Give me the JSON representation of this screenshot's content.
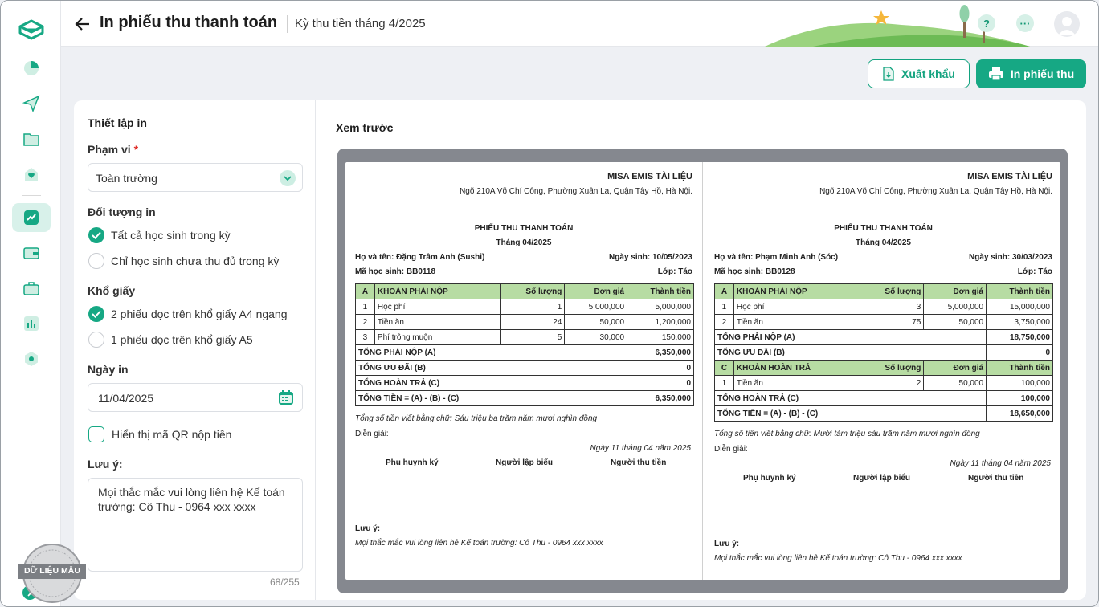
{
  "header": {
    "title": "In phiếu thu thanh toán",
    "period": "Kỳ thu tiền tháng 4/2025",
    "help_label": "?",
    "more_label": "···"
  },
  "actions": {
    "export_label": "Xuất khẩu",
    "print_label": "In phiếu thu"
  },
  "settings": {
    "title": "Thiết lập in",
    "scope_label": "Phạm vi",
    "scope_required": "*",
    "scope_value": "Toàn trường",
    "target_label": "Đối tượng in",
    "target_options": [
      "Tất cả học sinh trong kỳ",
      "Chỉ học sinh chưa thu đủ trong kỳ"
    ],
    "paper_label": "Khổ giấy",
    "paper_options": [
      "2 phiếu dọc trên khổ giấy A4 ngang",
      "1 phiếu dọc trên khổ giấy A5"
    ],
    "date_label": "Ngày in",
    "date_value": "11/04/2025",
    "qr_label": "Hiển thị mã QR nộp tiền",
    "note_label": "Lưu ý:",
    "note_value": "Mọi thắc mắc vui lòng liên hệ Kế toán trường: Cô Thu - 0964 xxx xxxx",
    "note_counter": "68/255",
    "sample_badge": "DỮ LIỆU MẪU"
  },
  "preview": {
    "title": "Xem trước",
    "slips": [
      {
        "school": "MISA EMIS TÀI LIỆU",
        "address": "Ngõ 210A Võ Chí Công, Phường Xuân La, Quận Tây Hồ, Hà Nội.",
        "title": "PHIẾU THU THANH TOÁN",
        "month": "Tháng 04/2025",
        "name": "Họ và tên: Đặng Trâm Anh (Sushi)",
        "dob": "Ngày sinh: 10/05/2023",
        "code": "Mã học sinh: BB0118",
        "class": "Lớp: Táo",
        "header": [
          "A",
          "KHOẢN PHẢI NỘP",
          "Số lượng",
          "Đơn giá",
          "Thành tiền"
        ],
        "rows": [
          [
            "1",
            "Học phí",
            "1",
            "5,000,000",
            "5,000,000"
          ],
          [
            "2",
            "Tiền ăn",
            "24",
            "50,000",
            "1,200,000"
          ],
          [
            "3",
            "Phí trông muộn",
            "5",
            "30,000",
            "150,000"
          ]
        ],
        "tot_a": [
          "TỔNG PHẢI NỘP (A)",
          "6,350,000"
        ],
        "tot_b": [
          "TỔNG ƯU ĐÃI (B)",
          "0"
        ],
        "tot_c": [
          "TỔNG HOÀN TRẢ (C)",
          "0"
        ],
        "tot_all": [
          "TỔNG TIỀN = (A) - (B) - (C)",
          "6,350,000"
        ],
        "words": "Tổng số tiền viết bằng chữ: Sáu triệu ba trăm năm mươi nghìn đồng",
        "explain": "Diễn giải:",
        "date": "Ngày 11 tháng 04 năm 2025",
        "signers": [
          "Phụ huynh ký",
          "Người lập biểu",
          "Người thu tiền"
        ],
        "note_label": "Lưu ý:",
        "note": "Mọi thắc mắc vui lòng liên hệ Kế toán trường: Cô Thu - 0964 xxx xxxx"
      },
      {
        "school": "MISA EMIS TÀI LIỆU",
        "address": "Ngõ 210A Võ Chí Công, Phường Xuân La, Quận Tây Hồ, Hà Nội.",
        "title": "PHIẾU THU THANH TOÁN",
        "month": "Tháng 04/2025",
        "name": "Họ và tên: Phạm Minh Anh (Sóc)",
        "dob": "Ngày sinh: 30/03/2023",
        "code": "Mã học sinh: BB0128",
        "class": "Lớp: Táo",
        "header": [
          "A",
          "KHOẢN PHẢI NỘP",
          "Số lượng",
          "Đơn giá",
          "Thành tiền"
        ],
        "rows": [
          [
            "1",
            "Học phí",
            "3",
            "5,000,000",
            "15,000,000"
          ],
          [
            "2",
            "Tiền ăn",
            "75",
            "50,000",
            "3,750,000"
          ]
        ],
        "tot_a": [
          "TỔNG PHẢI NỘP (A)",
          "18,750,000"
        ],
        "tot_b": [
          "TỔNG ƯU ĐÃI (B)",
          "0"
        ],
        "refund_header": [
          "C",
          "KHOẢN HOÀN TRẢ",
          "Số lượng",
          "Đơn giá",
          "Thành tiền"
        ],
        "refund_rows": [
          [
            "1",
            "Tiền ăn",
            "2",
            "50,000",
            "100,000"
          ]
        ],
        "tot_c": [
          "TỔNG HOÀN TRẢ (C)",
          "100,000"
        ],
        "tot_all": [
          "TỔNG TIỀN = (A) - (B) - (C)",
          "18,650,000"
        ],
        "words": "Tổng số tiền viết bằng chữ: Mười tám triệu sáu trăm năm mươi nghìn đồng",
        "explain": "Diễn giải:",
        "date": "Ngày 11 tháng 04 năm 2025",
        "signers": [
          "Phụ huynh ký",
          "Người lập biểu",
          "Người thu tiền"
        ],
        "note_label": "Lưu ý:",
        "note": "Mọi thắc mắc vui lòng liên hệ Kế toán trường: Cô Thu - 0964 xxx xxxx"
      }
    ]
  },
  "colors": {
    "accent": "#16a884",
    "table_header": "#b7dca3"
  }
}
